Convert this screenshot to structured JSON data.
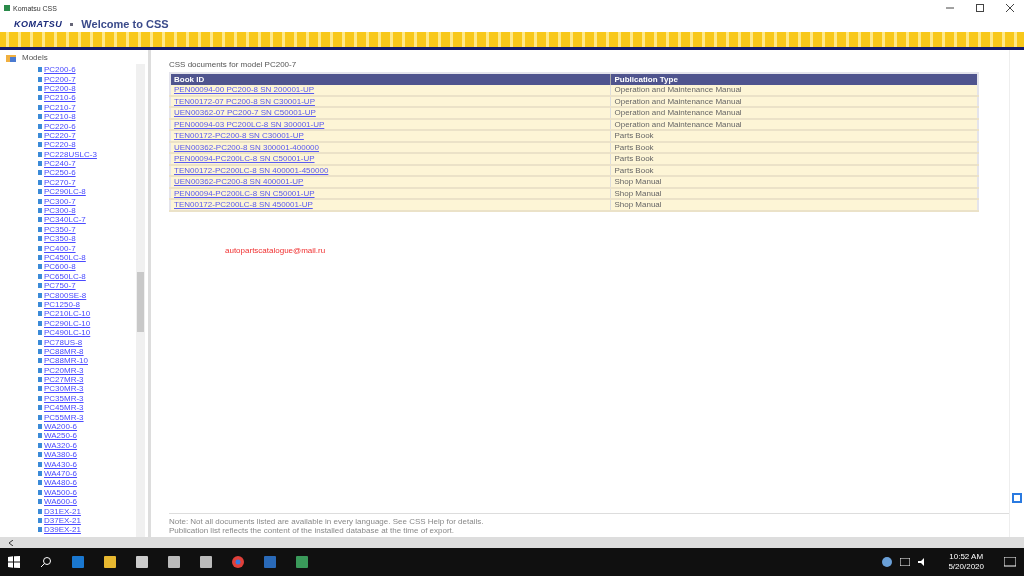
{
  "window": {
    "title": "Komatsu CSS"
  },
  "header": {
    "logo": "KOMATSU",
    "title": "Welcome to CSS"
  },
  "sidebar": {
    "root": "Models",
    "items": [
      {
        "label": "PC200-6"
      },
      {
        "label": "PC200-7"
      },
      {
        "label": "PC200-8"
      },
      {
        "label": "PC210-6"
      },
      {
        "label": "PC210-7"
      },
      {
        "label": "PC210-8"
      },
      {
        "label": "PC220-6"
      },
      {
        "label": "PC220-7"
      },
      {
        "label": "PC220-8"
      },
      {
        "label": "PC228USLC-3"
      },
      {
        "label": "PC240-7"
      },
      {
        "label": "PC250-6"
      },
      {
        "label": "PC270-7"
      },
      {
        "label": "PC290LC-8"
      },
      {
        "label": "PC300-7"
      },
      {
        "label": "PC300-8"
      },
      {
        "label": "PC340LC-7"
      },
      {
        "label": "PC350-7"
      },
      {
        "label": "PC350-8"
      },
      {
        "label": "PC400-7"
      },
      {
        "label": "PC450LC-8"
      },
      {
        "label": "PC600-8"
      },
      {
        "label": "PC650LC-8"
      },
      {
        "label": "PC750-7"
      },
      {
        "label": "PC800SE-8"
      },
      {
        "label": "PC1250-8"
      },
      {
        "label": "PC210LC-10"
      },
      {
        "label": "PC290LC-10"
      },
      {
        "label": "PC490LC-10"
      },
      {
        "label": "PC78US-8"
      },
      {
        "label": "PC88MR-8"
      },
      {
        "label": "PC88MR-10"
      },
      {
        "label": "PC20MR-3"
      },
      {
        "label": "PC27MR-3"
      },
      {
        "label": "PC30MR-3"
      },
      {
        "label": "PC35MR-3"
      },
      {
        "label": "PC45MR-3"
      },
      {
        "label": "PC55MR-3"
      },
      {
        "label": "WA200-6"
      },
      {
        "label": "WA250-6"
      },
      {
        "label": "WA320-6"
      },
      {
        "label": "WA380-6"
      },
      {
        "label": "WA430-6"
      },
      {
        "label": "WA470-6"
      },
      {
        "label": "WA480-6"
      },
      {
        "label": "WA500-6"
      },
      {
        "label": "WA600-6"
      },
      {
        "label": "D31EX-21"
      },
      {
        "label": "D37EX-21"
      },
      {
        "label": "D39EX-21"
      }
    ]
  },
  "content": {
    "heading": "CSS documents for model PC200-7",
    "table": {
      "columns": [
        "Book ID",
        "Publication Type"
      ],
      "rows": [
        [
          "PEN00094-00 PC200-8 SN 200001-UP",
          "Operation and Maintenance Manual"
        ],
        [
          "TEN00172-07 PC200-8 SN C30001-UP",
          "Operation and Maintenance Manual"
        ],
        [
          "UEN00362-07 PC200-7 SN C50001-UP",
          "Operation and Maintenance Manual"
        ],
        [
          "PEN00094-03 PC200LC-8 SN 300001-UP",
          "Operation and Maintenance Manual"
        ],
        [
          "TEN00172-PC200-8 SN C30001-UP",
          "Parts Book"
        ],
        [
          "UEN00362-PC200-8 SN 300001-400000",
          "Parts Book"
        ],
        [
          "PEN00094-PC200LC-8 SN C50001-UP",
          "Parts Book"
        ],
        [
          "TEN00172-PC200LC-8 SN 400001-450000",
          "Parts Book"
        ],
        [
          "UEN00362-PC200-8 SN 400001-UP",
          "Shop Manual"
        ],
        [
          "PEN00094-PC200LC-8 SN C50001-UP",
          "Shop Manual"
        ],
        [
          "TEN00172-PC200LC-8 SN 450001-UP",
          "Shop Manual"
        ]
      ]
    },
    "notice": "autopartscatalogue@mail.ru",
    "footer": [
      "Note: Not all documents listed are available in every language. See CSS Help for details.",
      "Publication list reflects the content of the installed database at the time of export."
    ]
  },
  "taskbar": {
    "time": "10:52 AM",
    "date": "5/20/2020"
  }
}
